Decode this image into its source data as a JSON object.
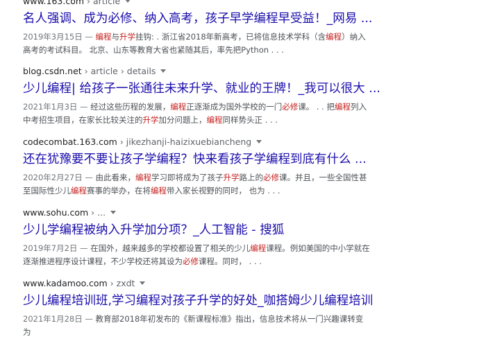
{
  "results": [
    {
      "site": "www.163.com",
      "path": " › article",
      "title": "名人强调、成为必修、纳入高考，孩子早学编程早受益！_网易 ...",
      "date": "2019年3月15日 — ",
      "snippet": [
        {
          "t": "",
          "h": "编程"
        },
        {
          "t": "与",
          "h": "升学"
        },
        {
          "t": "挂钩: . 浙江省2018年新高考，已将信息技术学科（含",
          "h": "编程"
        },
        {
          "t": "）纳入高考的考试科目。 北京、山东等教育大省也紧随其后，率先把Python . . .",
          "h": ""
        }
      ]
    },
    {
      "site": "blog.csdn.net",
      "path": " › article › details",
      "title": "少儿编程| 给孩子一张通往未来升学、就业的王牌！_我可以很大 ...",
      "date": "2021年1月3日 — ",
      "snippet": [
        {
          "t": "经过这些历程的发展，",
          "h": "编程"
        },
        {
          "t": "正逐渐成为国外学校的一门",
          "h": "必修"
        },
        {
          "t": "课。 . . 把",
          "h": "编程"
        },
        {
          "t": "列入中考招生项目，在家长比较关注的",
          "h": "升学"
        },
        {
          "t": "加分问题上，",
          "h": "编程"
        },
        {
          "t": "同样势头正 . . .",
          "h": ""
        }
      ]
    },
    {
      "site": "codecombat.163.com",
      "path": " › jikezhanji-haizixuebiancheng",
      "title": "还在犹豫要不要让孩子学编程？快来看孩子学编程到底有什么 ...",
      "date": "2020年2月27日 — ",
      "snippet": [
        {
          "t": "由此看来，",
          "h": "编程"
        },
        {
          "t": "学习即将成为了孩子",
          "h": "升学"
        },
        {
          "t": "路上的",
          "h": "必修"
        },
        {
          "t": "课。并且，一些全国性甚至国际性少儿",
          "h": "编程"
        },
        {
          "t": "赛事的举办，在将",
          "h": "编程"
        },
        {
          "t": "带入家长视野的同时， 也为 . . .",
          "h": ""
        }
      ]
    },
    {
      "site": "www.sohu.com",
      "path": " › ...",
      "title": "少儿学编程被纳入升学加分项？_人工智能 - 搜狐",
      "date": "2019年7月2日 — ",
      "snippet": [
        {
          "t": "在国外，越来越多的学校都设置了相关的少儿",
          "h": "编程"
        },
        {
          "t": "课程。例如美国的中小学就在逐渐推进程序设计课程，不少学校还将其设为",
          "h": "必修"
        },
        {
          "t": "课程。同时， . . .",
          "h": ""
        }
      ]
    },
    {
      "site": "www.kadamoo.com",
      "path": " › zxdt",
      "title": "少儿编程培训班,学习编程对孩子升学的好处_咖搭姆少儿编程培训",
      "date": "2021年1月28日 — ",
      "snippet": [
        {
          "t": "教育部2018年初发布的《新课程标准》指出，信息技术将从一门兴趣课转变为",
          "h": ""
        }
      ]
    }
  ]
}
